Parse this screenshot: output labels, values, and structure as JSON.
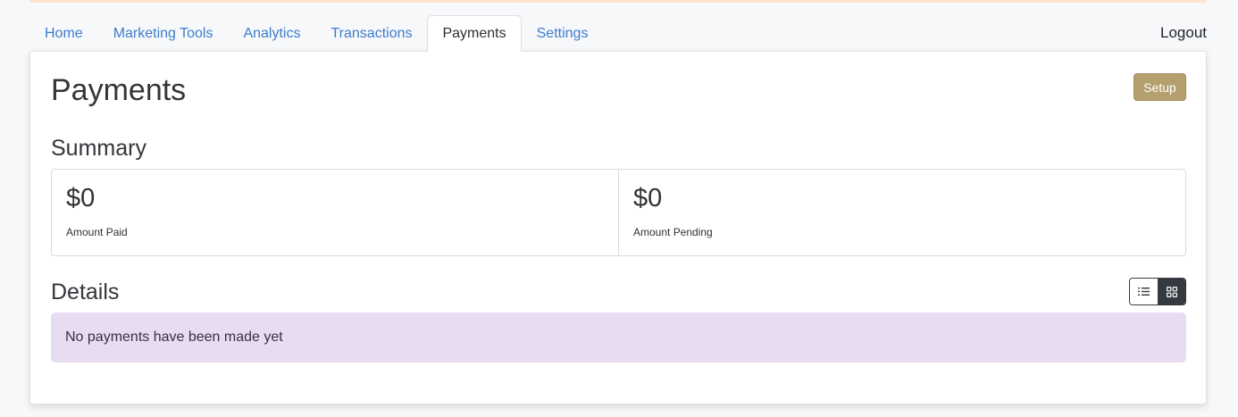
{
  "nav": {
    "tabs": [
      {
        "label": "Home"
      },
      {
        "label": "Marketing Tools"
      },
      {
        "label": "Analytics"
      },
      {
        "label": "Transactions"
      },
      {
        "label": "Payments",
        "active": true
      },
      {
        "label": "Settings"
      }
    ],
    "logout_label": "Logout"
  },
  "page": {
    "title": "Payments",
    "setup_label": "Setup"
  },
  "summary": {
    "title": "Summary",
    "stats": [
      {
        "value": "$0",
        "label": "Amount Paid"
      },
      {
        "value": "$0",
        "label": "Amount Pending"
      }
    ]
  },
  "details": {
    "title": "Details",
    "view_modes": [
      {
        "icon": "list-icon",
        "selected": false
      },
      {
        "icon": "grid-icon",
        "selected": true
      }
    ],
    "empty_message": "No payments have been made yet"
  },
  "colors": {
    "link": "#3d7ccc",
    "setup_button": "#b59f6e",
    "alert_bg": "#e8dcf0",
    "toggle_dark": "#343a40"
  }
}
